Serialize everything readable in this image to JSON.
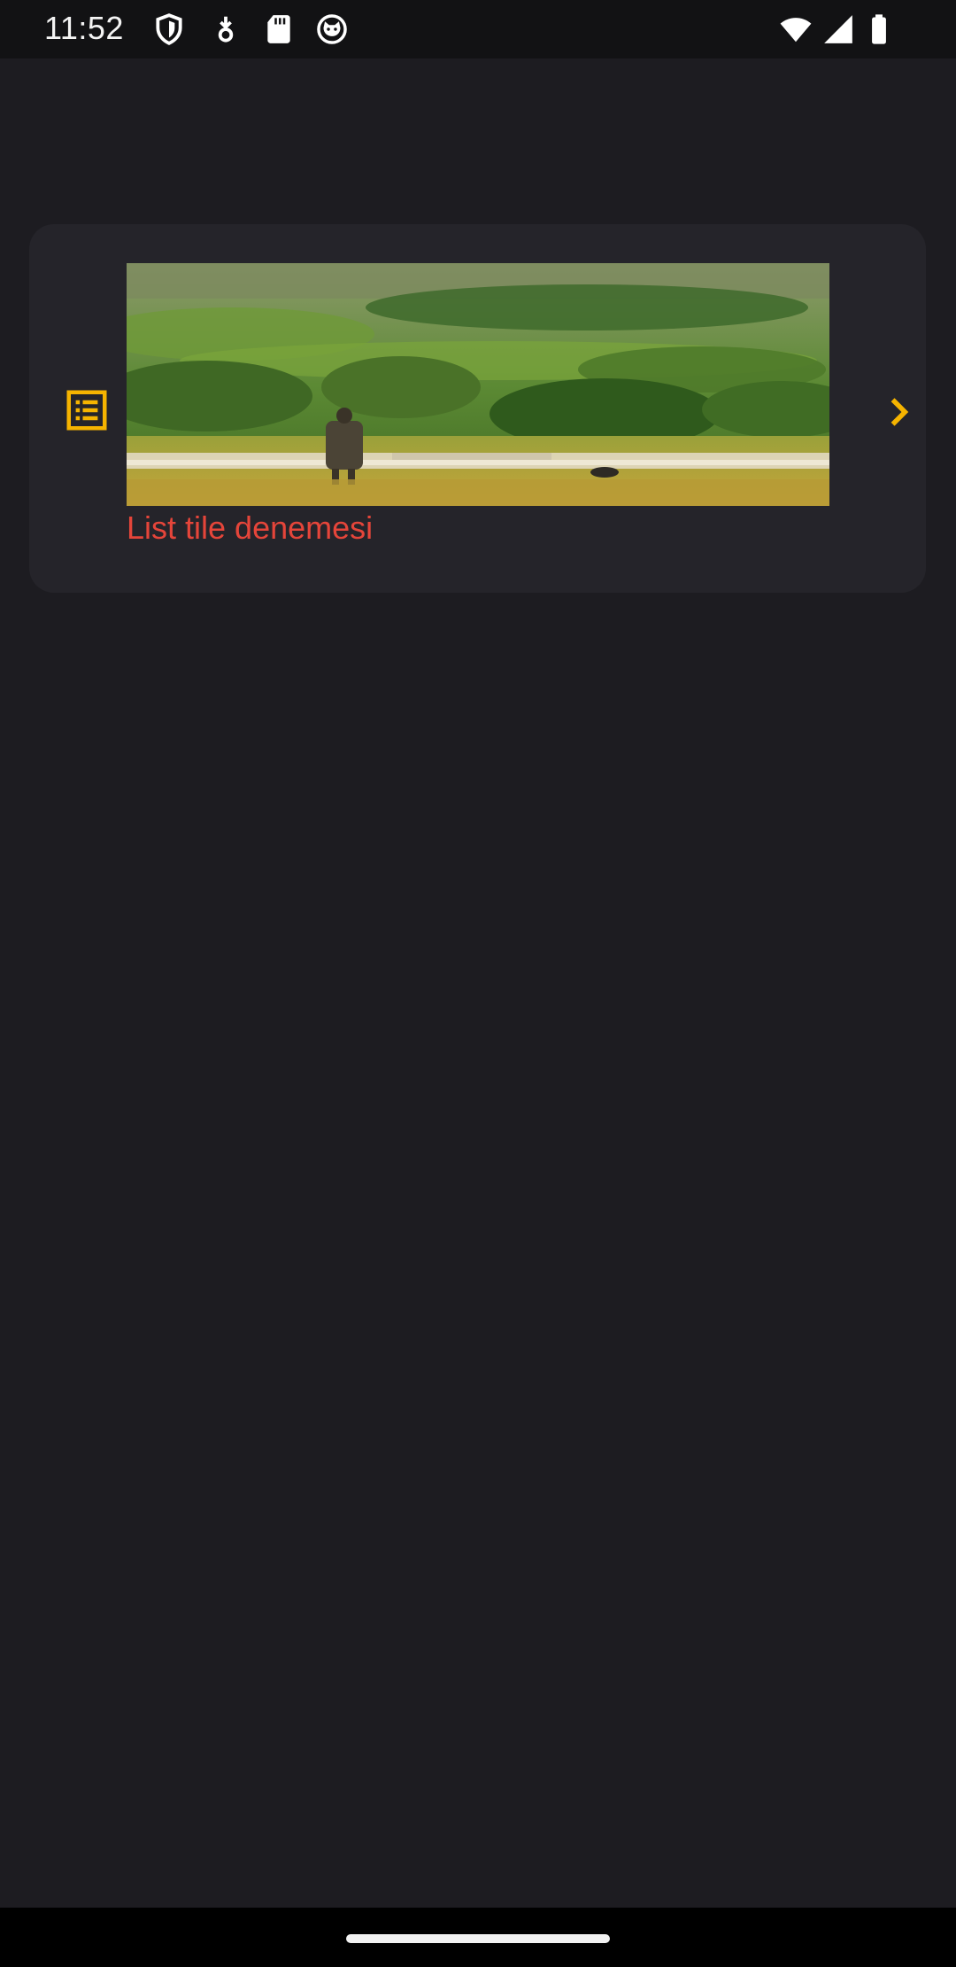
{
  "status_bar": {
    "time": "11:52",
    "left_icons": [
      "shield-icon",
      "download-indicator-icon",
      "sd-card-icon",
      "cat-face-icon"
    ],
    "right_icons": [
      "wifi-icon",
      "cellular-signal-icon",
      "battery-icon"
    ]
  },
  "list_tile": {
    "leading_icon": "list-alt-icon",
    "image": "landscape-photo-shepherd-with-flock",
    "title": "List tile denemesi",
    "trailing_icon": "chevron-right-icon"
  },
  "colors": {
    "background": "#1d1c21",
    "card": "#25242a",
    "accent": "#f6b400",
    "title": "#e5453a"
  }
}
